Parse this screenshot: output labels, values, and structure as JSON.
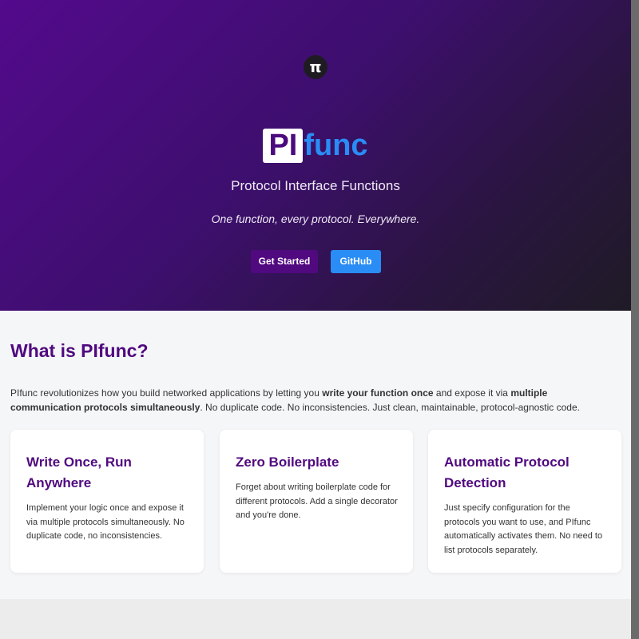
{
  "hero": {
    "logo_glyph": "π",
    "brand_prefix": "PI",
    "brand_suffix": "func",
    "subtitle": "Protocol Interface Functions",
    "tagline": "One function, every protocol. Everywhere.",
    "buttons": {
      "get_started": "Get Started",
      "github": "GitHub"
    }
  },
  "about": {
    "heading": "What is PIfunc?",
    "intro": [
      "PIfunc revolutionizes how you build networked applications by letting you ",
      "write your function once",
      " and expose it via ",
      "multiple communication protocols simultaneously",
      ". No duplicate code. No inconsistencies. Just clean, maintainable, protocol-agnostic code."
    ],
    "cards": [
      {
        "title": "Write Once, Run Anywhere",
        "text": "Implement your logic once and expose it via multiple protocols simultaneously. No duplicate code, no inconsistencies."
      },
      {
        "title": "Zero Boilerplate",
        "text": "Forget about writing boilerplate code for different protocols. Add a single decorator and you're done."
      },
      {
        "title": "Automatic Protocol Detection",
        "text": "Just specify configuration for the protocols you want to use, and PIfunc automatically activates them. No need to list protocols separately."
      }
    ]
  },
  "colors": {
    "brand_purple": "#50097f",
    "accent_blue": "#2a8cf5"
  }
}
